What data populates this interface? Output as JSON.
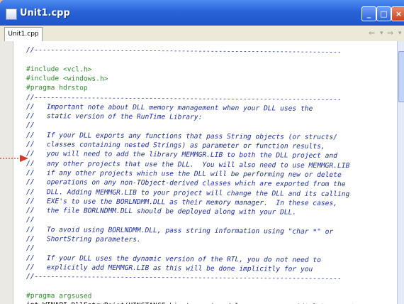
{
  "window": {
    "title": "Unit1.cpp",
    "buttons": {
      "minimize": "_",
      "maximize": "□",
      "close": "×"
    },
    "colors": {
      "titlebar": "#2a63d8",
      "close_button": "#c8431f"
    }
  },
  "tabs": [
    {
      "label": "Unit1.cpp"
    }
  ],
  "nav": {
    "back": "⇐",
    "forward": "⇒",
    "dropdown": "▾"
  },
  "code_lines": [
    {
      "text": "//---------------------------------------------------------------------------",
      "kind": "comment"
    },
    {
      "text": "",
      "kind": "code"
    },
    {
      "text": "#include <vcl.h>",
      "kind": "pre"
    },
    {
      "text": "#include <windows.h>",
      "kind": "pre"
    },
    {
      "text": "#pragma hdrstop",
      "kind": "pre"
    },
    {
      "text": "//---------------------------------------------------------------------------",
      "kind": "comment"
    },
    {
      "text": "//   Important note about DLL memory management when your DLL uses the",
      "kind": "comment"
    },
    {
      "text": "//   static version of the RunTime Library:",
      "kind": "comment"
    },
    {
      "text": "//",
      "kind": "comment"
    },
    {
      "text": "//   If your DLL exports any functions that pass String objects (or structs/",
      "kind": "comment"
    },
    {
      "text": "//   classes containing nested Strings) as parameter or function results,",
      "kind": "comment"
    },
    {
      "text": "//   you will need to add the library MEMMGR.LIB to both the DLL project and",
      "kind": "comment"
    },
    {
      "text": "//   any other projects that use the DLL.  You will also need to use MEMMGR.LIB",
      "kind": "comment"
    },
    {
      "text": "//   if any other projects which use the DLL will be performing new or delete",
      "kind": "comment"
    },
    {
      "text": "//   operations on any non-TObject-derived classes which are exported from the",
      "kind": "comment"
    },
    {
      "text": "//   DLL. Adding MEMMGR.LIB to your project will change the DLL and its calling",
      "kind": "comment"
    },
    {
      "text": "//   EXE's to use the BORLNDMM.DLL as their memory manager.  In these cases,",
      "kind": "comment"
    },
    {
      "text": "//   the file BORLNDMM.DLL should be deployed along with your DLL.",
      "kind": "comment"
    },
    {
      "text": "//",
      "kind": "comment"
    },
    {
      "text": "//   To avoid using BORLNDMM.DLL, pass string information using \"char *\" or",
      "kind": "comment"
    },
    {
      "text": "//   ShortString parameters.",
      "kind": "comment"
    },
    {
      "text": "//",
      "kind": "comment"
    },
    {
      "text": "//   If your DLL uses the dynamic version of the RTL, you do not need to",
      "kind": "comment"
    },
    {
      "text": "//   explicitly add MEMMGR.LIB as this will be done implicitly for you",
      "kind": "comment"
    },
    {
      "text": "//---------------------------------------------------------------------------",
      "kind": "comment"
    },
    {
      "text": "",
      "kind": "code"
    },
    {
      "text": "#pragma argsused",
      "kind": "pre"
    },
    {
      "text": "int WINAPI DllEntryPoint(HINSTANCE hinst, unsigned long reason, void* lpReserved)",
      "kind": "code"
    }
  ],
  "annotation": {
    "arrow_color": "#d23a2a"
  }
}
